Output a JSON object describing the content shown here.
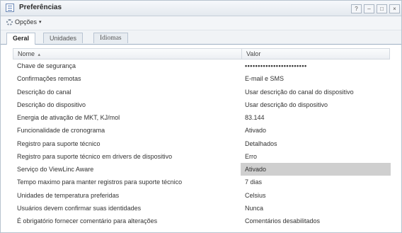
{
  "window": {
    "title": "Preferências",
    "controls": [
      "?",
      "–",
      "□",
      "×"
    ]
  },
  "toolbar": {
    "options_label": "Opções",
    "options_caret": "▾"
  },
  "tabs": [
    {
      "label": "Geral",
      "active": true
    },
    {
      "label": "Unidades",
      "active": false
    },
    {
      "label": "Idiomas",
      "active": false
    }
  ],
  "grid": {
    "columns": {
      "name": "Nome",
      "value": "Valor"
    },
    "sort_indicator": "▴",
    "rows": [
      {
        "name": "Chave de segurança",
        "value": "••••••••••••••••••••••••",
        "masked": true
      },
      {
        "name": "Confirmações remotas",
        "value": "E-mail e SMS"
      },
      {
        "name": "Descrição do canal",
        "value": "Usar descrição do canal do dispositivo"
      },
      {
        "name": "Descrição do dispositivo",
        "value": "Usar descrição do dispositivo"
      },
      {
        "name": "Energia de ativação de MKT, KJ/mol",
        "value": "83.144"
      },
      {
        "name": "Funcionalidade de cronograma",
        "value": "Ativado"
      },
      {
        "name": "Registro para suporte técnico",
        "value": "Detalhados"
      },
      {
        "name": "Registro para suporte técnico em drivers de dispositivo",
        "value": "Erro"
      },
      {
        "name": "Serviço do ViewLinc Aware",
        "value": "Ativado",
        "selected": true
      },
      {
        "name": "Tempo maximo para manter registros para suporte técnico",
        "value": "7 dias"
      },
      {
        "name": "Unidades de temperatura preferidas",
        "value": "Celsius"
      },
      {
        "name": "Usuários devem confirmar suas identidades",
        "value": "Nunca"
      },
      {
        "name": "É obrigatório fornecer comentário para alterações",
        "value": "Comentários desabilitados"
      }
    ]
  }
}
